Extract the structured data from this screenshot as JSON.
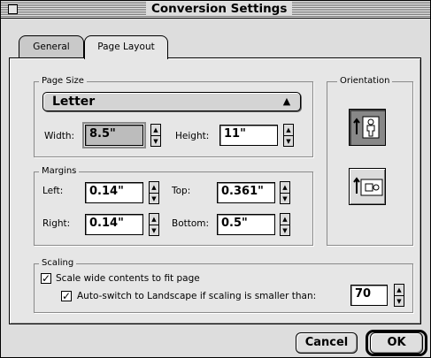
{
  "window": {
    "title": "Conversion Settings"
  },
  "tabs": [
    {
      "label": "General"
    },
    {
      "label": "Page Layout"
    }
  ],
  "page_size": {
    "group_label": "Page Size",
    "selected": "Letter",
    "width_label": "Width:",
    "width_value": "8.5\"",
    "height_label": "Height:",
    "height_value": "11\""
  },
  "orientation": {
    "group_label": "Orientation",
    "options": [
      "portrait",
      "landscape"
    ],
    "selected": "portrait"
  },
  "margins": {
    "group_label": "Margins",
    "left_label": "Left:",
    "left_value": "0.14\"",
    "top_label": "Top:",
    "top_value": "0.361\"",
    "right_label": "Right:",
    "right_value": "0.14\"",
    "bottom_label": "Bottom:",
    "bottom_value": "0.5\""
  },
  "scaling": {
    "group_label": "Scaling",
    "scale_wide_label": "Scale wide contents to fit page",
    "scale_wide_checked": true,
    "auto_switch_label": "Auto-switch to Landscape if scaling is smaller than:",
    "auto_switch_checked": true,
    "threshold_value": "70"
  },
  "buttons": {
    "cancel": "Cancel",
    "ok": "OK"
  }
}
